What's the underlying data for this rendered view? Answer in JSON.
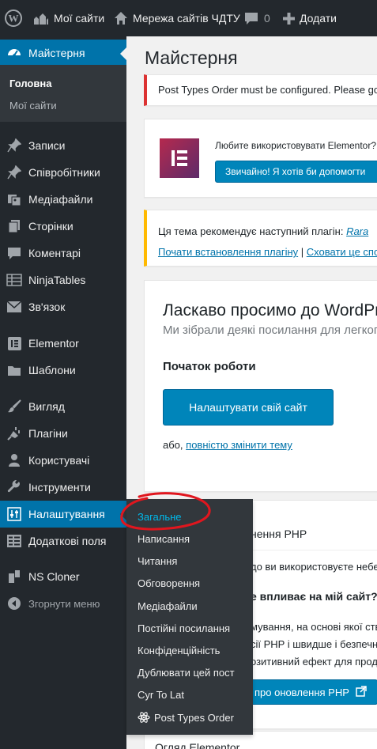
{
  "adminbar": {
    "my_sites": "Мої сайти",
    "network": "Мережа сайтів ЧДТУ",
    "comments_count": "0",
    "add_new": "Додати"
  },
  "sidebar": {
    "dashboard": "Майстерня",
    "home": "Головна",
    "my_sites": "Мої сайти",
    "items": [
      {
        "label": "Записи",
        "icon": "pin-icon"
      },
      {
        "label": "Співробітники",
        "icon": "pin-icon"
      },
      {
        "label": "Медіафайли",
        "icon": "media-icon"
      },
      {
        "label": "Сторінки",
        "icon": "page-icon"
      },
      {
        "label": "Коментарі",
        "icon": "comment-icon"
      },
      {
        "label": "NinjaTables",
        "icon": "table-icon"
      },
      {
        "label": "Зв'язок",
        "icon": "mail-icon"
      },
      {
        "label": "Elementor",
        "icon": "elementor-icon"
      },
      {
        "label": "Шаблони",
        "icon": "folder-icon"
      },
      {
        "label": "Вигляд",
        "icon": "brush-icon"
      },
      {
        "label": "Плагіни",
        "icon": "plugin-icon"
      },
      {
        "label": "Користувачі",
        "icon": "user-icon"
      },
      {
        "label": "Інструменти",
        "icon": "wrench-icon"
      },
      {
        "label": "Налаштування",
        "icon": "settings-icon"
      },
      {
        "label": "Додаткові поля",
        "icon": "fields-icon"
      },
      {
        "label": "NS Cloner",
        "icon": "cloner-icon"
      },
      {
        "label": "Згорнути меню",
        "icon": "collapse-icon"
      }
    ]
  },
  "flyout": [
    "Загальне",
    "Написання",
    "Читання",
    "Обговорення",
    "Медіафайли",
    "Постійні посилання",
    "Конфіденційність",
    "Дублювати цей пост",
    "Cyr To Lat",
    "Post Types Order"
  ],
  "main": {
    "title": "Майстерня",
    "notice_red": "Post Types Order must be configured. Please go to",
    "elementor_text": "Любите використовувати Elementor?",
    "elementor_button": "Звичайно! Я хотів би допомогти",
    "notice_yellow_text": "Ця тема рекомендує наступний плагін:",
    "notice_yellow_plugin": "Rara",
    "notice_yellow_link1": "Почати встановлення плагіну",
    "notice_yellow_sep": "|",
    "notice_yellow_link2": "Сховати це сповіщення",
    "welcome_title": "Ласкаво просимо до WordPress!",
    "welcome_sub": "Ми зібрали деякі посилання для легкого старту:",
    "start_heading": "Початок роботи",
    "customize_button": "Налаштувати свій сайт",
    "or_text": "або,",
    "change_theme_link": "повністю змінити тему",
    "php_title_fragment": "нення PHP",
    "php_line1": "до ви використовуєте небе",
    "php_heading": "е впливає на мій сайт?",
    "php_line2": "мування, на основі якої ств",
    "php_line3": "сії PHP і швидше і безпечн",
    "php_line4": "озитивний ефект для прод",
    "php_button": "про оновлення PHP",
    "overview_title": "Огляд Elementor"
  }
}
